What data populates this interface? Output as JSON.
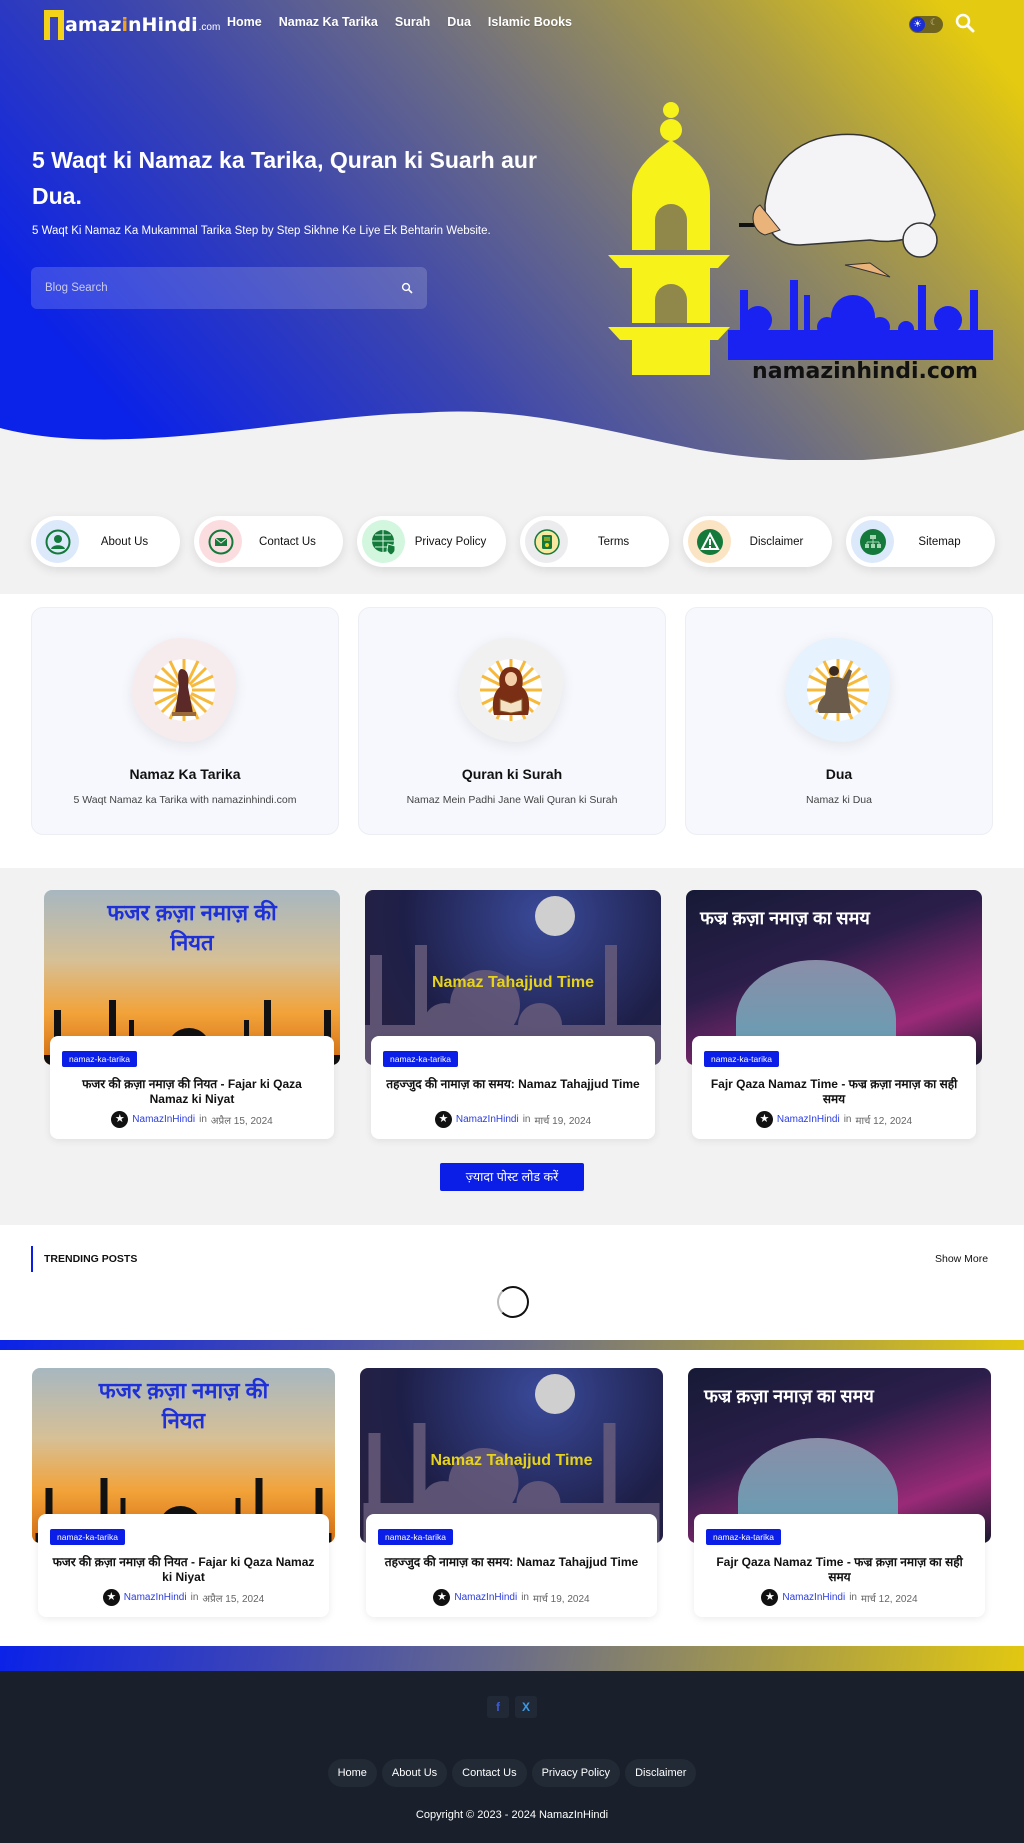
{
  "header": {
    "logo_text": "amaz",
    "logo_accent": "i",
    "logo_text2": "nHindi",
    "logo_suffix": ".com",
    "menu": [
      "Home",
      "Namaz Ka Tarika",
      "Surah",
      "Dua",
      "Islamic Books"
    ],
    "theme_toggle": {
      "light_icon": "☀",
      "dark_icon": "☾"
    }
  },
  "hero": {
    "title": "5 Waqt ki Namaz ka Tarika, Quran ki Suarh aur Dua.",
    "subtitle": "5 Waqt Ki Namaz Ka Mukammal Tarika Step by Step Sikhne Ke Liye Ek Behtarin Website.",
    "search_placeholder": "Blog Search",
    "art_caption": "namazinhindi.com"
  },
  "quick_links": [
    {
      "label": "About Us",
      "icon": "user-icon",
      "bg": "#dbe9fb"
    },
    {
      "label": "Contact Us",
      "icon": "mail-icon",
      "bg": "#fbdde0"
    },
    {
      "label": "Privacy Policy",
      "icon": "globe-shield-icon",
      "bg": "#d3f6de"
    },
    {
      "label": "Terms",
      "icon": "document-icon",
      "bg": "#ececee"
    },
    {
      "label": "Disclaimer",
      "icon": "warning-icon",
      "bg": "#fbe4c4"
    },
    {
      "label": "Sitemap",
      "icon": "sitemap-icon",
      "bg": "#dbe9fb"
    }
  ],
  "categories": [
    {
      "title": "Namaz Ka Tarika",
      "desc": "5 Waqt Namaz ka Tarika with namazinhindi.com",
      "blob": "#f6ecee"
    },
    {
      "title": "Quran ki Surah",
      "desc": "Namaz Mein Padhi Jane Wali Quran ki Surah",
      "blob": "#f1f1f1"
    },
    {
      "title": "Dua",
      "desc": "Namaz ki Dua",
      "blob": "#e6f2fd"
    }
  ],
  "posts": [
    {
      "tag": "namaz-ka-tarika",
      "title": "फजर की क़ज़ा नमाज़ की नियत - Fajar ki Qaza Namaz ki Niyat",
      "author": "NamazInHindi",
      "in": "in",
      "date": "अप्रैल 15, 2024",
      "img_text": "फजर क़ज़ा नमाज़ की नियत"
    },
    {
      "tag": "namaz-ka-tarika",
      "title": "तहज्जुद की नामाज़ का समय: Namaz Tahajjud Time",
      "author": "NamazInHindi",
      "in": "in",
      "date": "मार्च 19, 2024",
      "img_text": "Namaz Tahajjud Time"
    },
    {
      "tag": "namaz-ka-tarika",
      "title": "Fajr Qaza Namaz Time - फज्र क़ज़ा नमाज़ का सही समय",
      "author": "NamazInHindi",
      "in": "in",
      "date": "मार्च 12, 2024",
      "img_text": "फज्र क़ज़ा नमाज़ का समय"
    }
  ],
  "load_more": "ज़्यादा पोस्ट लोड करें",
  "trending": {
    "title": "TRENDING POSTS",
    "show_more": "Show More"
  },
  "footer": {
    "social": [
      {
        "name": "facebook",
        "glyph": "f",
        "color": "#3b5bd6"
      },
      {
        "name": "x",
        "glyph": "X",
        "color": "#3b9be8"
      }
    ],
    "links": [
      "Home",
      "About Us",
      "Contact Us",
      "Privacy Policy",
      "Disclaimer"
    ],
    "copyright": "Copyright © 2023 - 2024 NamazInHindi"
  },
  "colors": {
    "accent": "#0a1ee8",
    "brand_yellow": "#e2c811",
    "footer_bg": "#19202b"
  }
}
